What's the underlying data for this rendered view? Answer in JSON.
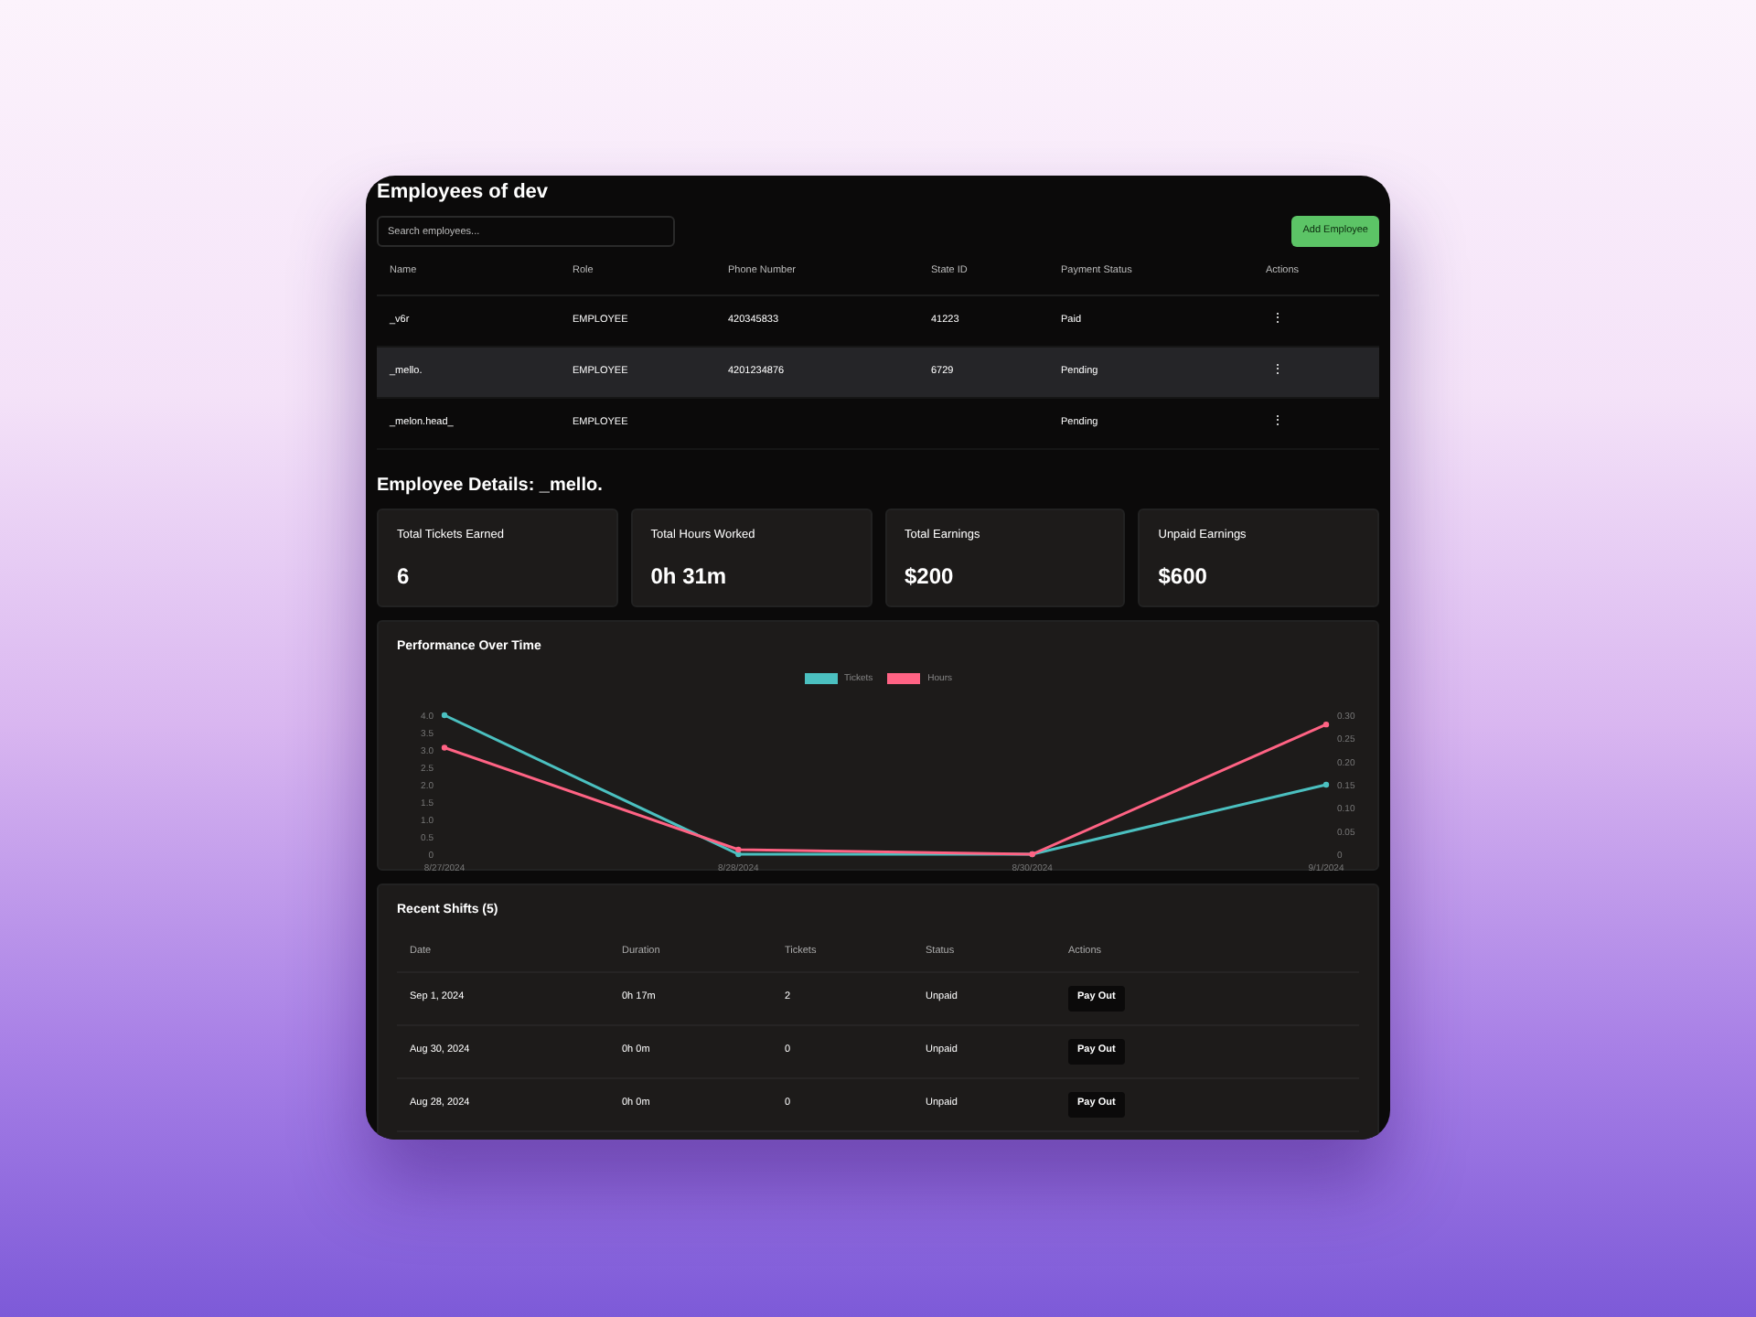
{
  "title": "Employees of dev",
  "search": {
    "placeholder": "Search employees..."
  },
  "add_button": "Add Employee",
  "table": {
    "columns": [
      "Name",
      "Role",
      "Phone Number",
      "State ID",
      "Payment Status",
      "Actions"
    ],
    "rows": [
      {
        "cells": [
          "_v6r",
          "EMPLOYEE",
          "420345833",
          "41223",
          "Paid"
        ],
        "action": "⋮",
        "selected": false
      },
      {
        "cells": [
          "_mello.",
          "EMPLOYEE",
          "4201234876",
          "6729",
          "Pending"
        ],
        "action": "⋮",
        "selected": true
      },
      {
        "cells": [
          "_melon.head_",
          "EMPLOYEE",
          "",
          "",
          "Pending"
        ],
        "action": "⋮",
        "selected": false
      }
    ]
  },
  "details_title": "Employee Details: _mello.",
  "stats": [
    {
      "label": "Total Tickets Earned",
      "value": "6"
    },
    {
      "label": "Total Hours Worked",
      "value": "0h 31m"
    },
    {
      "label": "Total Earnings",
      "value": "$200"
    },
    {
      "label": "Unpaid Earnings",
      "value": "$600"
    }
  ],
  "performance": {
    "title": "Performance Over Time",
    "chart_data": {
      "type": "line",
      "legend": "top",
      "ylim": [
        0,
        4
      ],
      "y2lim": [
        0,
        0.3
      ],
      "x": [
        "8/27/2024",
        "8/28/2024",
        "8/30/2024",
        "9/1/2024"
      ],
      "series": [
        {
          "name": "Tickets",
          "color": "#4bc0c0",
          "marker": "o",
          "axis": "y",
          "values": [
            4,
            0,
            0,
            2
          ]
        },
        {
          "name": "Hours",
          "color": "#ff6384",
          "marker": "o",
          "axis": "y2",
          "values": [
            0.23,
            0.01,
            0,
            0.28
          ]
        }
      ],
      "yticks": [
        {
          "value": 0,
          "label": "0"
        },
        {
          "value": 0.5,
          "label": "0.5"
        },
        {
          "value": 1,
          "label": "1.0"
        },
        {
          "value": 1.5,
          "label": "1.5"
        },
        {
          "value": 2,
          "label": "2.0"
        },
        {
          "value": 2.5,
          "label": "2.5"
        },
        {
          "value": 3,
          "label": "3.0"
        },
        {
          "value": 3.5,
          "label": "3.5"
        },
        {
          "value": 4,
          "label": "4.0"
        }
      ],
      "y2ticks": [
        {
          "value": 0,
          "label": "0"
        },
        {
          "value": 0.05,
          "label": "0.05"
        },
        {
          "value": 0.1,
          "label": "0.10"
        },
        {
          "value": 0.15,
          "label": "0.15"
        },
        {
          "value": 0.2,
          "label": "0.20"
        },
        {
          "value": 0.25,
          "label": "0.25"
        },
        {
          "value": 0.3,
          "label": "0.30"
        }
      ]
    }
  },
  "shifts": {
    "title": "Recent Shifts (5)",
    "columns": [
      "Date",
      "Duration",
      "Tickets",
      "Status",
      "Actions"
    ],
    "rows": [
      {
        "cells": [
          "Sep 1, 2024",
          "0h 17m",
          "2",
          "Unpaid"
        ],
        "action": "Pay Out"
      },
      {
        "cells": [
          "Aug 30, 2024",
          "0h 0m",
          "0",
          "Unpaid"
        ],
        "action": "Pay Out"
      },
      {
        "cells": [
          "Aug 28, 2024",
          "0h 0m",
          "0",
          "Unpaid"
        ],
        "action": "Pay Out"
      }
    ]
  }
}
